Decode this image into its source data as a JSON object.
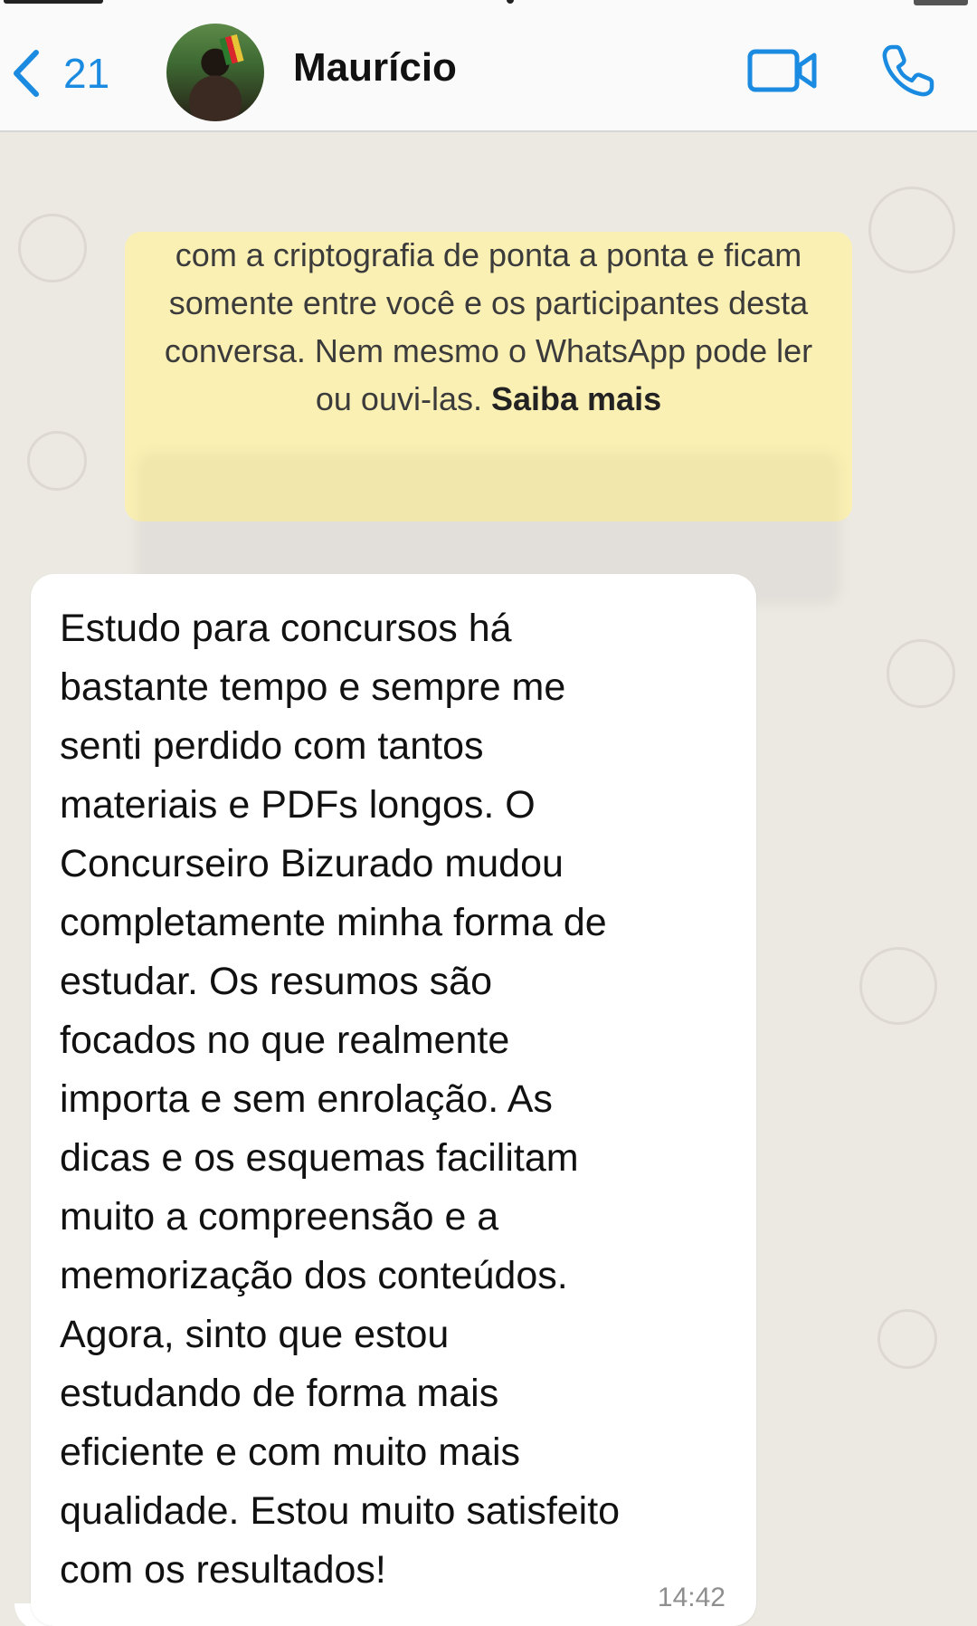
{
  "header": {
    "back_count": "21",
    "contact_name": "Maurício",
    "icons": {
      "back": "chevron-left-icon",
      "video": "video-camera-icon",
      "call": "phone-icon"
    },
    "accent_color": "#1a8be0"
  },
  "encryption_notice": {
    "text": "As mensagens e as ligações são protegidas com a criptografia de ponta a ponta e ficam somente entre você e os participantes desta conversa. Nem mesmo o WhatsApp pode ler ou ouvi-las.",
    "link_label": "Saiba mais",
    "background_color": "#fbf0b4"
  },
  "message": {
    "text": "Estudo para concursos há\nbastante tempo e sempre me\nsenti perdido com tantos\nmateriais e PDFs longos. O\nConcurseiro Bizurado mudou\ncompletamente minha forma de\nestudar. Os resumos são\nfocados no que realmente\nimporta e sem enrolação. As\ndicas e os esquemas facilitam\nmuito a compreensão e a\nmemorização dos conteúdos.\nAgora, sinto que estou\nestudando de forma mais\neficiente e com muito mais\nqualidade. Estou muito satisfeito\ncom os resultados!",
    "time": "14:42"
  }
}
